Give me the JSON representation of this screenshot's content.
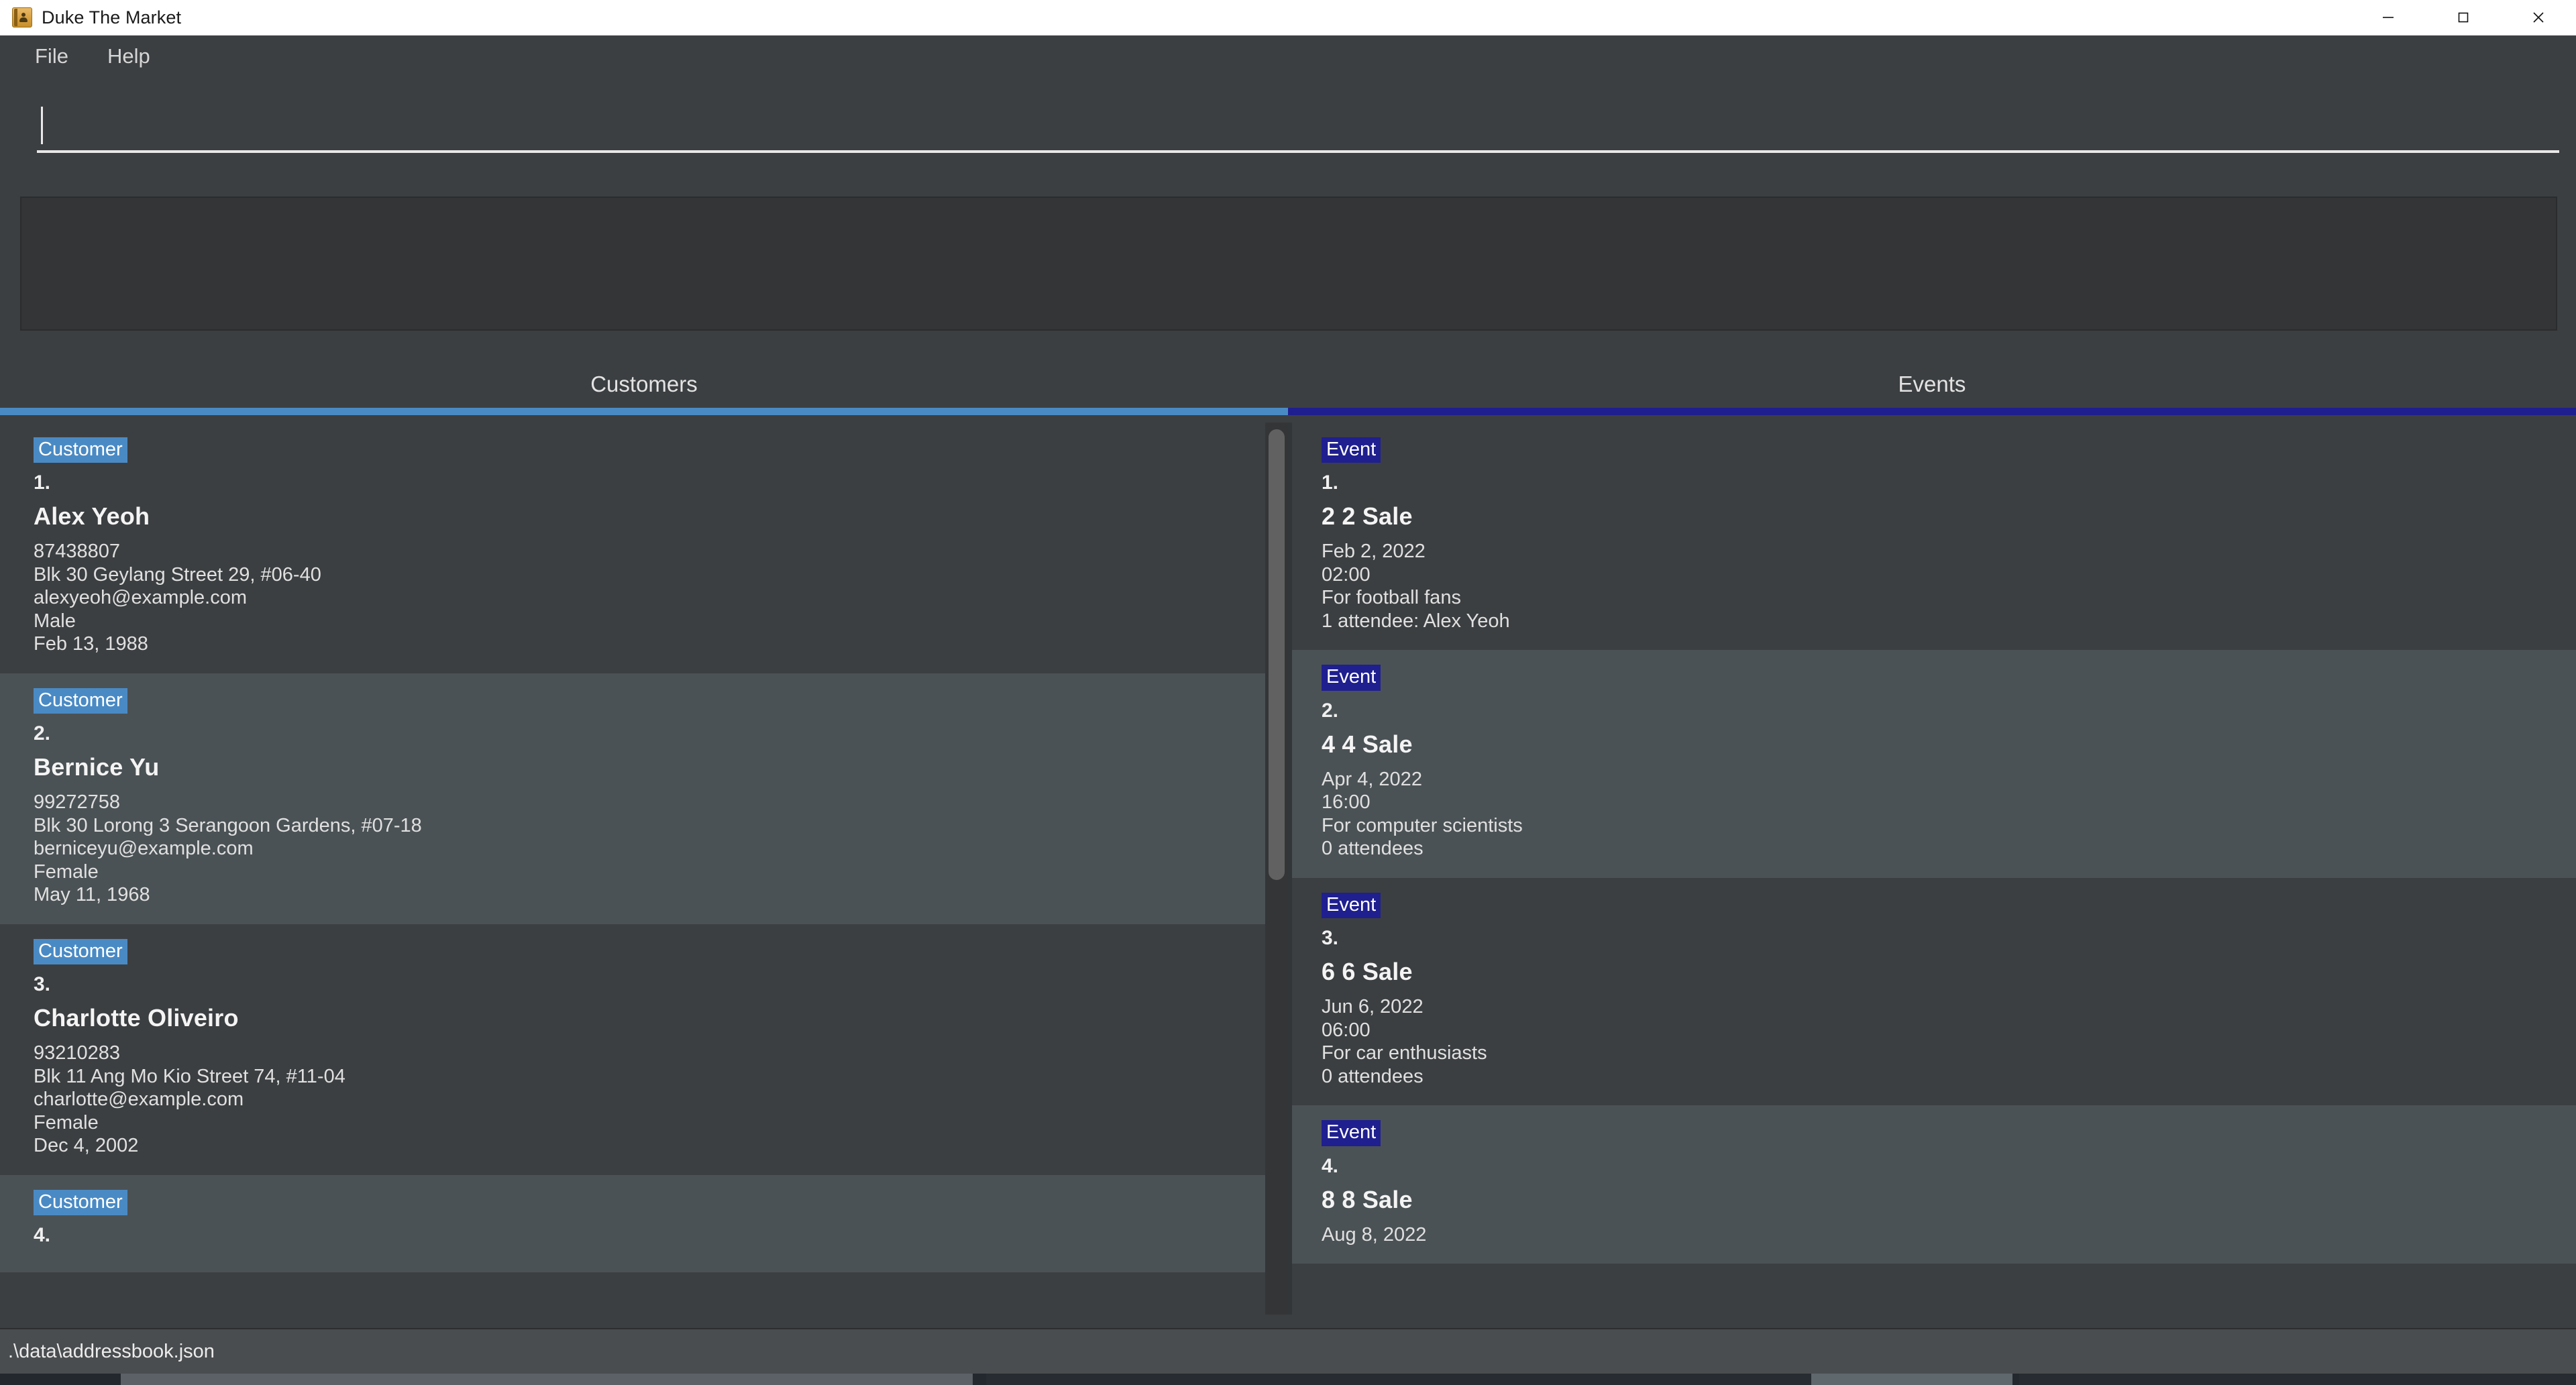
{
  "window": {
    "title": "Duke The Market",
    "icon": "address-book-icon",
    "controls": {
      "minimize": "–",
      "maximize": "□",
      "close": "✕"
    }
  },
  "menubar": {
    "items": [
      {
        "label": "File"
      },
      {
        "label": "Help"
      }
    ]
  },
  "command_box": {
    "value": "",
    "placeholder": ""
  },
  "result_display": {
    "text": ""
  },
  "tabs": [
    {
      "label": "Customers",
      "active": true,
      "accent": "#4a8ac4"
    },
    {
      "label": "Events",
      "active": false,
      "accent": "#1f1f8f"
    }
  ],
  "customers_panel": {
    "badge_label": "Customer",
    "badge_color": "#4a8ac4",
    "items": [
      {
        "index": "1.",
        "name": "Alex Yeoh",
        "phone": "87438807",
        "address": "Blk 30 Geylang Street 29, #06-40",
        "email": "alexyeoh@example.com",
        "gender": "Male",
        "birthday": "Feb 13, 1988"
      },
      {
        "index": "2.",
        "name": "Bernice Yu",
        "phone": "99272758",
        "address": "Blk 30 Lorong 3 Serangoon Gardens, #07-18",
        "email": "berniceyu@example.com",
        "gender": "Female",
        "birthday": "May 11, 1968"
      },
      {
        "index": "3.",
        "name": "Charlotte Oliveiro",
        "phone": "93210283",
        "address": "Blk 11 Ang Mo Kio Street 74, #11-04",
        "email": "charlotte@example.com",
        "gender": "Female",
        "birthday": "Dec 4, 2002"
      },
      {
        "index": "4.",
        "name": "",
        "phone": "",
        "address": "",
        "email": "",
        "gender": "",
        "birthday": ""
      }
    ]
  },
  "events_panel": {
    "badge_label": "Event",
    "badge_color": "#1f1f8f",
    "items": [
      {
        "index": "1.",
        "name": "2 2 Sale",
        "date": "Feb 2, 2022",
        "time": "02:00",
        "description": "For football fans",
        "attendees": "1 attendee: Alex Yeoh"
      },
      {
        "index": "2.",
        "name": "4 4 Sale",
        "date": "Apr 4, 2022",
        "time": "16:00",
        "description": "For computer scientists",
        "attendees": "0 attendees"
      },
      {
        "index": "3.",
        "name": "6 6 Sale",
        "date": "Jun 6, 2022",
        "time": "06:00",
        "description": "For car enthusiasts",
        "attendees": "0 attendees"
      },
      {
        "index": "4.",
        "name": "8 8 Sale",
        "date": "Aug 8, 2022",
        "time": "",
        "description": "",
        "attendees": ""
      }
    ]
  },
  "statusbar": {
    "file_path": ".\\data\\addressbook.json"
  }
}
